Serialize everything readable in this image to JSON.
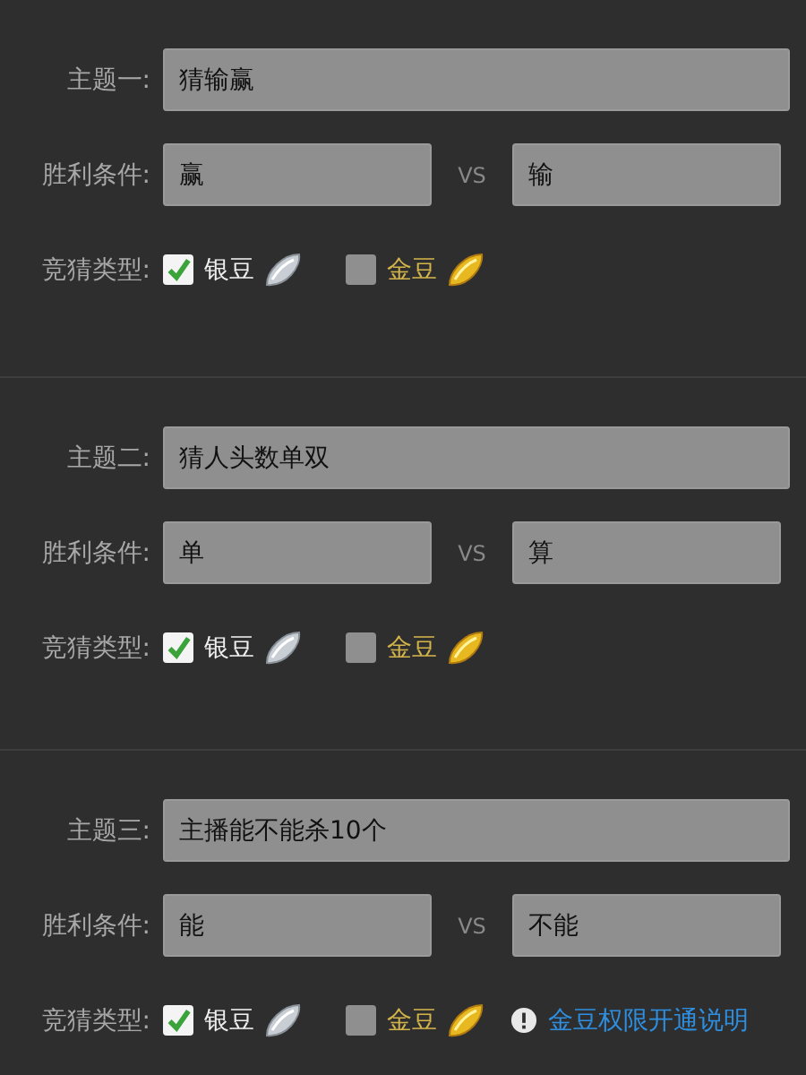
{
  "sections": [
    {
      "topic_label": "主题一:",
      "topic": "猜输赢",
      "condition_label": "胜利条件:",
      "option_a": "赢",
      "vs": "VS",
      "option_b": "输",
      "type_label": "竞猜类型:",
      "currencies": [
        {
          "kind": "silver",
          "label": "银豆",
          "checked": true
        },
        {
          "kind": "gold",
          "label": "金豆",
          "checked": false
        }
      ]
    },
    {
      "topic_label": "主题二:",
      "topic": "猜人头数单双",
      "condition_label": "胜利条件:",
      "option_a": "单",
      "vs": "VS",
      "option_b": "算",
      "type_label": "竞猜类型:",
      "currencies": [
        {
          "kind": "silver",
          "label": "银豆",
          "checked": true
        },
        {
          "kind": "gold",
          "label": "金豆",
          "checked": false
        }
      ]
    },
    {
      "topic_label": "主题三:",
      "topic": "主播能不能杀10个",
      "condition_label": "胜利条件:",
      "option_a": "能",
      "vs": "VS",
      "option_b": "不能",
      "type_label": "竞猜类型:",
      "currencies": [
        {
          "kind": "silver",
          "label": "银豆",
          "checked": true
        },
        {
          "kind": "gold",
          "label": "金豆",
          "checked": false
        }
      ],
      "help_link": "金豆权限开通说明"
    }
  ]
}
